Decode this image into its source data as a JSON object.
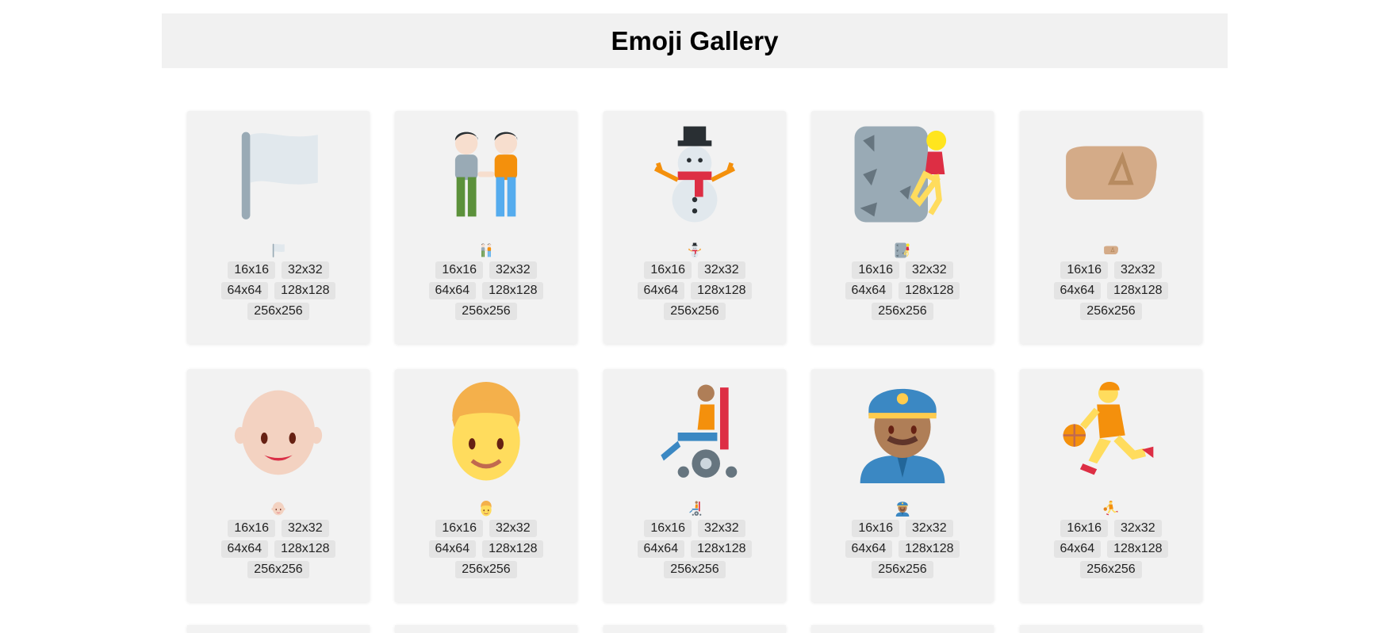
{
  "header": {
    "title": "Emoji Gallery"
  },
  "sizes": [
    "16x16",
    "32x32",
    "64x64",
    "128x128",
    "256x256"
  ],
  "emojis": [
    {
      "name": "white-flag-icon",
      "label": "white flag"
    },
    {
      "name": "people-holding-hands-icon",
      "label": "people holding hands"
    },
    {
      "name": "snowman-icon",
      "label": "snowman"
    },
    {
      "name": "person-climbing-icon",
      "label": "person climbing"
    },
    {
      "name": "right-facing-fist-icon",
      "label": "right-facing fist"
    },
    {
      "name": "bald-person-icon",
      "label": "bald person"
    },
    {
      "name": "curly-haired-person-icon",
      "label": "curly haired person"
    },
    {
      "name": "person-in-motorized-wheelchair-icon",
      "label": "person in motorized wheelchair"
    },
    {
      "name": "police-officer-icon",
      "label": "police officer"
    },
    {
      "name": "person-bouncing-ball-icon",
      "label": "person bouncing ball"
    }
  ]
}
